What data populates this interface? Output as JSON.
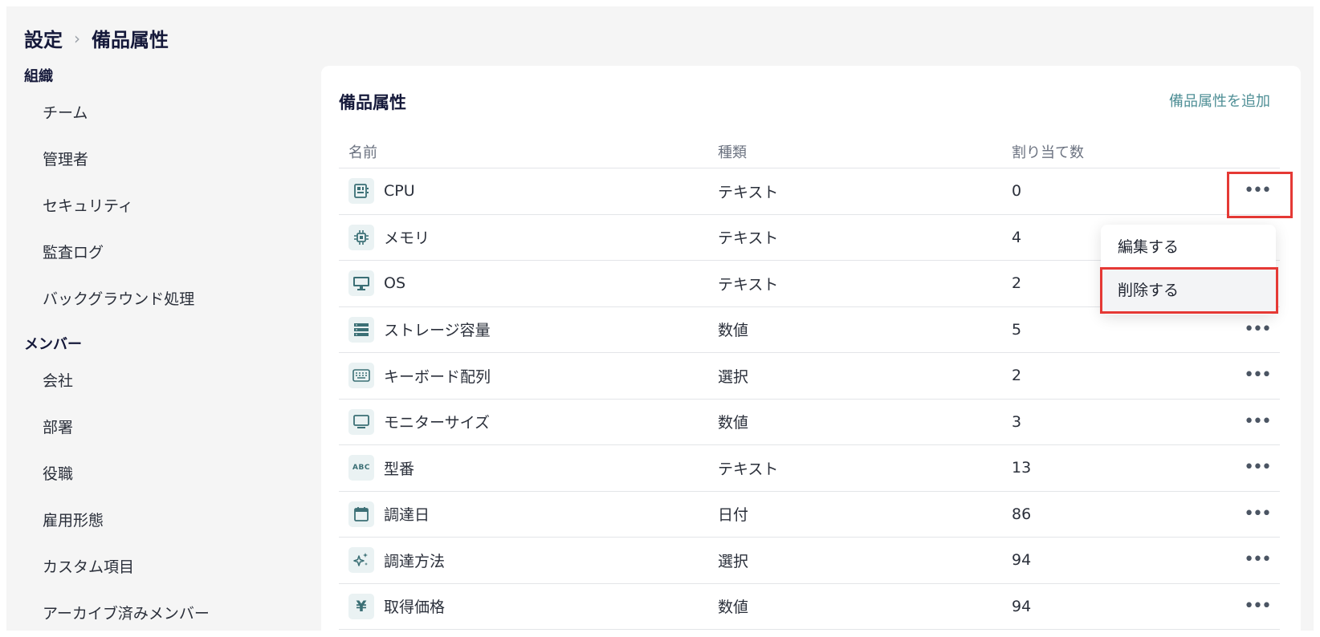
{
  "breadcrumb": {
    "parent": "設定",
    "separator": "›",
    "current": "備品属性"
  },
  "sidebar": {
    "sections": [
      {
        "title": "組織",
        "items": [
          "チーム",
          "管理者",
          "セキュリティ",
          "監査ログ",
          "バックグラウンド処理"
        ]
      },
      {
        "title": "メンバー",
        "items": [
          "会社",
          "部署",
          "役職",
          "雇用形態",
          "カスタム項目",
          "アーカイブ済みメンバー"
        ]
      }
    ]
  },
  "card": {
    "title": "備品属性",
    "add_label": "備品属性を追加",
    "columns": {
      "name": "名前",
      "type": "種類",
      "count": "割り当て数"
    },
    "rows": [
      {
        "name": "CPU",
        "type": "テキスト",
        "count": "0",
        "icon": "cpu-icon"
      },
      {
        "name": "メモリ",
        "type": "テキスト",
        "count": "4",
        "icon": "memory-chip-icon"
      },
      {
        "name": "OS",
        "type": "テキスト",
        "count": "2",
        "icon": "desktop-icon"
      },
      {
        "name": "ストレージ容量",
        "type": "数値",
        "count": "5",
        "icon": "storage-icon"
      },
      {
        "name": "キーボード配列",
        "type": "選択",
        "count": "2",
        "icon": "keyboard-icon"
      },
      {
        "name": "モニターサイズ",
        "type": "数値",
        "count": "3",
        "icon": "monitor-icon"
      },
      {
        "name": "型番",
        "type": "テキスト",
        "count": "13",
        "icon": "abc-icon"
      },
      {
        "name": "調達日",
        "type": "日付",
        "count": "86",
        "icon": "calendar-icon"
      },
      {
        "name": "調達方法",
        "type": "選択",
        "count": "94",
        "icon": "sparkle-icon"
      },
      {
        "name": "取得価格",
        "type": "数値",
        "count": "94",
        "icon": "yen-icon"
      }
    ]
  },
  "menu": {
    "edit_label": "編集する",
    "delete_label": "削除する"
  },
  "icons": {
    "more": "•••",
    "abc": "ABC",
    "yen": "¥"
  },
  "colors": {
    "accent": "#4f8f96",
    "highlight": "#e53935",
    "background": "#f5f5f5"
  }
}
